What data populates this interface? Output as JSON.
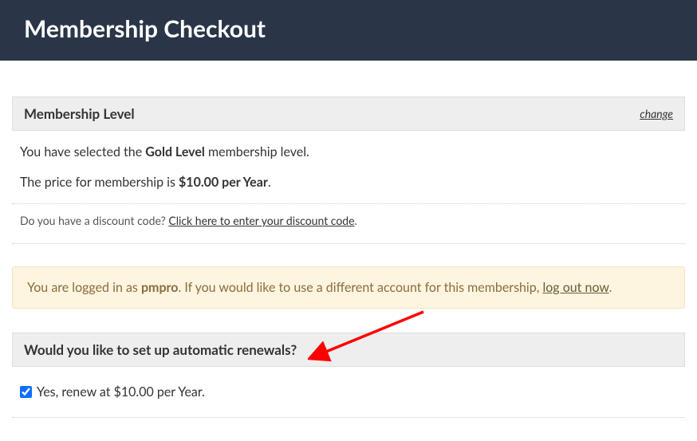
{
  "header": {
    "title": "Membership Checkout"
  },
  "level_section": {
    "title": "Membership Level",
    "change_link": "change",
    "selected_prefix": "You have selected the ",
    "selected_level": "Gold Level",
    "selected_suffix": " membership level.",
    "price_prefix": "The price for membership is ",
    "price": "$10.00 per Year",
    "price_suffix": ".",
    "discount_prompt": "Do you have a discount code? ",
    "discount_link": "Click here to enter your discount code",
    "discount_suffix": "."
  },
  "login_alert": {
    "prefix": "You are logged in as ",
    "username": "pmpro",
    "middle": ". If you would like to use a different account for this membership, ",
    "logout_link": "log out now",
    "suffix": "."
  },
  "renewal_section": {
    "title": "Would you like to set up automatic renewals?",
    "checkbox_label": "Yes, renew at $10.00 per Year."
  }
}
